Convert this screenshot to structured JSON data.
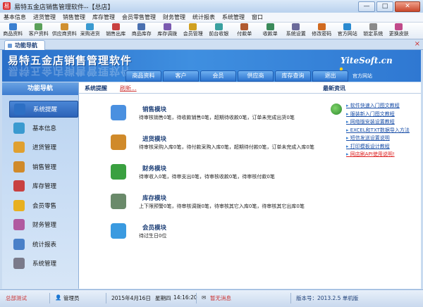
{
  "window": {
    "title": "易特五金店销售管理软件--【总店】",
    "controls": [
      "—",
      "□",
      "✕"
    ]
  },
  "menu": [
    "基本信息",
    "进货管理",
    "销售管理",
    "库存管理",
    "会员零售管理",
    "财务管理",
    "统计报表",
    "系统管理",
    "窗口"
  ],
  "toolbar": [
    {
      "label": "商品资料",
      "color": "#3a7fd0"
    },
    {
      "label": "客户资料",
      "color": "#5aa05a"
    },
    {
      "label": "供应商资料",
      "color": "#d09030"
    },
    {
      "label": "采购进货",
      "color": "#3a9ad0"
    },
    {
      "label": "销售出库",
      "color": "#c84040"
    },
    {
      "label": "商品库存",
      "color": "#4a70b0"
    },
    {
      "label": "库存调拨",
      "color": "#7a5ab0"
    },
    {
      "label": "会员管理",
      "color": "#d0a020"
    },
    {
      "label": "前台收银",
      "color": "#3aa0a0"
    },
    {
      "label": "付款单",
      "color": "#b05a30"
    },
    {
      "label": "收款单",
      "color": "#3a8a5a"
    },
    {
      "label": "系统设置",
      "color": "#6a6a9a"
    },
    {
      "label": "修改密码",
      "color": "#d06a20"
    },
    {
      "label": "官方网站",
      "color": "#2a8ad0"
    },
    {
      "label": "锁定系统",
      "color": "#8a8a8a"
    },
    {
      "label": "更换皮肤",
      "color": "#c04a8a"
    }
  ],
  "tab": {
    "label": "功能导航",
    "close": "×"
  },
  "banner": {
    "brand": "易特五金店销售管理软件",
    "site": "YiteSoft.cn",
    "nav": [
      "商品资料",
      "客户",
      "会员",
      "供应商",
      "库存查询",
      "退出"
    ],
    "official": "官方网站"
  },
  "sidebar": {
    "title": "功能导航",
    "items": [
      {
        "label": "系统提醒",
        "color": "#2d6fc4",
        "active": true
      },
      {
        "label": "基本信息",
        "color": "#3a9ad0"
      },
      {
        "label": "进货管理",
        "color": "#e0a030"
      },
      {
        "label": "销售管理",
        "color": "#d08a2a"
      },
      {
        "label": "库存管理",
        "color": "#c84040"
      },
      {
        "label": "会员零售",
        "color": "#e8b020"
      },
      {
        "label": "财务管理",
        "color": "#b05aa0"
      },
      {
        "label": "统计报表",
        "color": "#4a80c8"
      },
      {
        "label": "系统管理",
        "color": "#7a7a8a"
      }
    ]
  },
  "main": {
    "tab_remind": "系统提醒",
    "refresh": "刷新...",
    "news_title": "最新资讯",
    "modules": [
      {
        "title": "销售模块",
        "desc": "待审核销售0笔，待收款销售0笔，超期待收款0笔，订单未完成出货0笔",
        "color": "#4a90e0"
      },
      {
        "title": "进货模块",
        "desc": "待审核采购入库0笔，待付款采购入库0笔，超期待付款0笔，订单未完成入库0笔",
        "color": "#d08a2a"
      },
      {
        "title": "财务模块",
        "desc": "待审收入0笔，待审支出0笔，待审核收款0笔，待审核付款0笔",
        "color": "#3aa040"
      },
      {
        "title": "库存模块",
        "desc": "上下限预警0笔，待审核调拨0笔，待审核其它入库0笔，待审核其它出库0笔",
        "color": "#6a8a6a"
      },
      {
        "title": "会员模块",
        "desc": "待过生日0位",
        "color": "#3a9ae0"
      }
    ],
    "news": [
      {
        "text": "软件快速入门图文教程",
        "red": false
      },
      {
        "text": "服装新入门图文教程",
        "red": false
      },
      {
        "text": "网络版安装设置教程",
        "red": false
      },
      {
        "text": "EXCEL和TXT数据导入方法",
        "red": false
      },
      {
        "text": "短信发送设置说明",
        "red": false
      },
      {
        "text": "打印模板设计教程",
        "red": false
      },
      {
        "text": "网店刷API使用说明!",
        "red": true
      }
    ]
  },
  "status": {
    "store": "总部测试",
    "user": "管理员",
    "date": "2015年4月16日",
    "weekday": "星期四",
    "time": "14:16:20",
    "message": "暂无消息",
    "version": "版本号：2013.2.5 单机版"
  }
}
